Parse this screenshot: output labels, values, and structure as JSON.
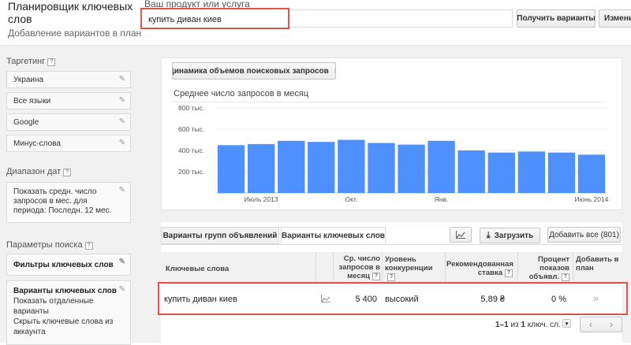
{
  "header": {
    "app_title": "Планировщик ключевых слов",
    "app_subtitle": "Добавление вариантов в план",
    "product_label": "Ваш продукт или услуга",
    "search_value": "купить диван киев",
    "get_variants_label": "Получить варианты",
    "change_label": "Измени"
  },
  "sidebar": {
    "targeting_label": "Таргетинг",
    "targeting_items": [
      "Украина",
      "Все языки",
      "Google",
      "Минус-слова"
    ],
    "date_label": "Диапазон дат",
    "date_value": "Показать средн. число запросов в мес. для периода: Последн. 12 мес.",
    "search_params_label": "Параметры поиска",
    "filter_label": "Фильтры ключевых слов",
    "variants_title": "Варианты ключевых слов",
    "variants_opt1": "Показать отдаленные варианты",
    "variants_opt2": "Скрыть ключевые слова из аккаунта"
  },
  "chart_panel": {
    "metric_select": "Динамика объемов поисковых запросов"
  },
  "chart_data": {
    "type": "bar",
    "title": "Среднее число запросов в месяц",
    "ylim": [
      0,
      800000
    ],
    "yticks": [
      "200 тыс.",
      "400 тыс.",
      "600 тыс.",
      "800 тыс."
    ],
    "ytick_values": [
      200000,
      400000,
      600000,
      800000
    ],
    "x_tick_labels": [
      {
        "index": 1,
        "label": "Июль 2013"
      },
      {
        "index": 4,
        "label": "Окт."
      },
      {
        "index": 7,
        "label": "Янв."
      },
      {
        "index": 12,
        "label": "Июнь 2014"
      }
    ],
    "values": [
      450000,
      460000,
      490000,
      480000,
      500000,
      470000,
      455000,
      490000,
      400000,
      380000,
      390000,
      380000,
      360000
    ],
    "bar_color": "#4d90fe",
    "grid": true
  },
  "tabs": [
    "Варианты групп объявлений",
    "Варианты ключевых слов"
  ],
  "toolbar": {
    "download_label": "Загрузить",
    "add_all_label": "Добавить все (801)"
  },
  "table": {
    "headers": {
      "keywords": "Ключевые слова",
      "avg_searches": "Ср. число запросов в месяц",
      "competition": "Уровень конкуренции",
      "suggested_bid": "Рекомендованная ставка",
      "impr_share": "Процент показов объявл.",
      "add_to_plan": "Добавить в план"
    },
    "rows": [
      {
        "keyword": "купить диван киев",
        "avg_searches": "5 400",
        "competition": "высокий",
        "bid": "5,89 ₴",
        "share": "0 %",
        "add": "»"
      }
    ]
  },
  "pager": {
    "range": "1–1",
    "of_label": "из",
    "total": "1",
    "unit": "ключ. сл."
  }
}
